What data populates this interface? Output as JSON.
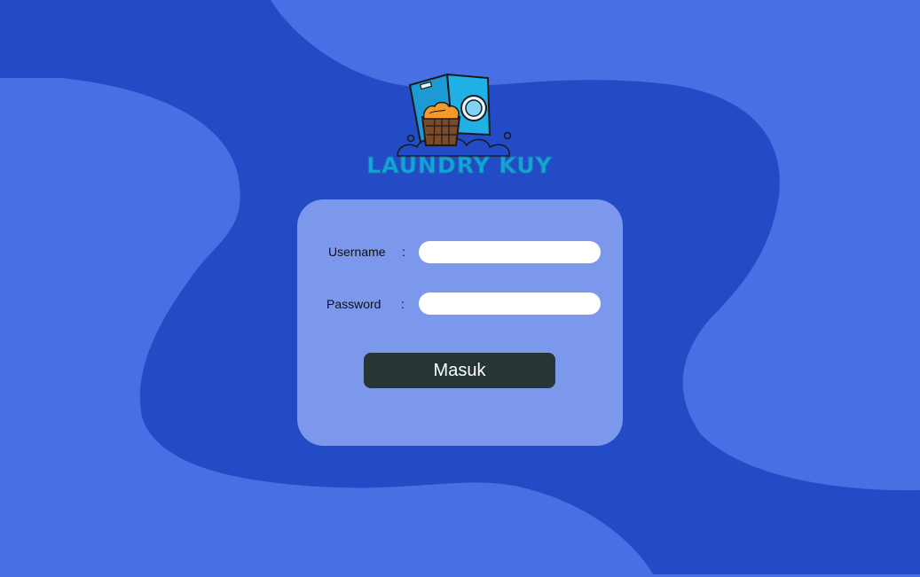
{
  "colors": {
    "background_dark": "#244bc6",
    "background_light": "#4870e4",
    "card": "#7b98ec",
    "button": "#283535",
    "logo_text": "#17a2d9"
  },
  "logo": {
    "text": "LAUNDRY KUY",
    "icon": "washing-machine-basket-icon"
  },
  "login_form": {
    "username_label": "Username",
    "username_colon": ":",
    "username_value": "",
    "password_label": "Password",
    "password_colon": ":",
    "password_value": "",
    "submit_label": "Masuk"
  }
}
